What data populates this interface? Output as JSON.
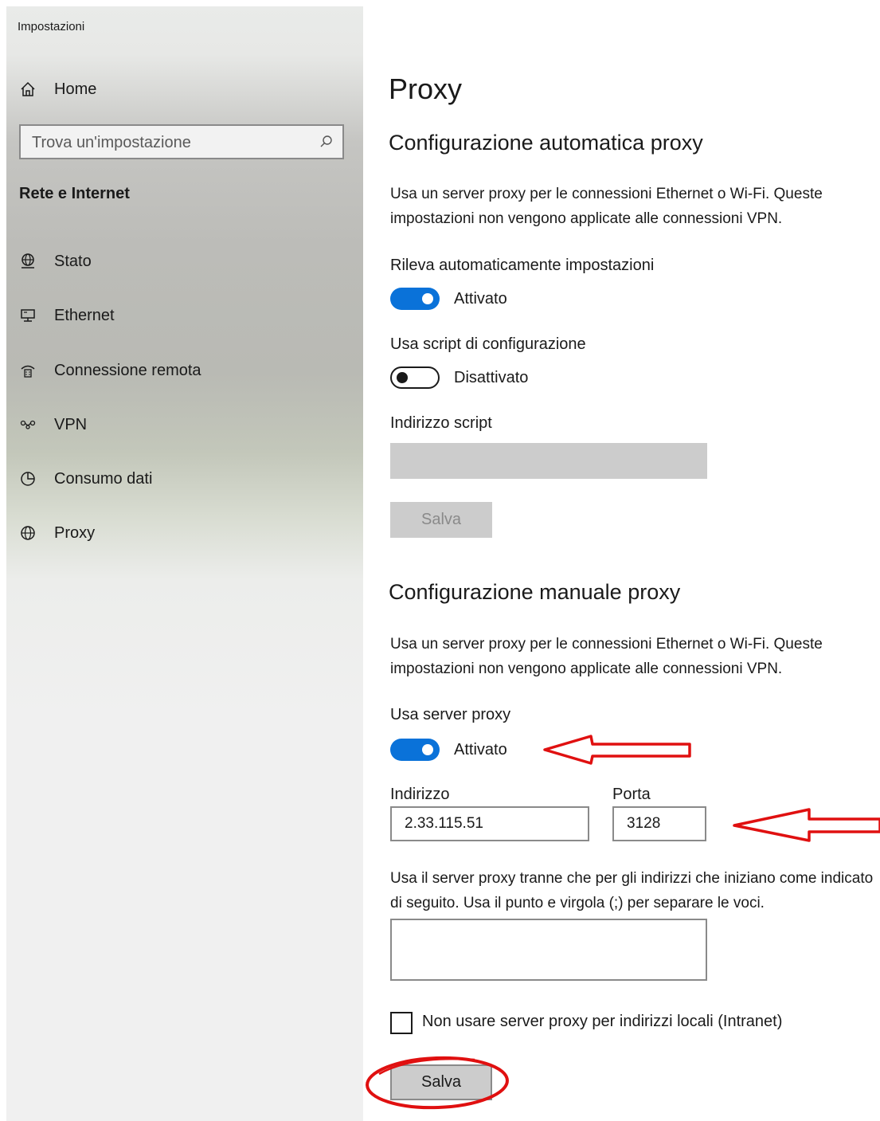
{
  "window": {
    "title": "Impostazioni"
  },
  "sidebar": {
    "home_label": "Home",
    "search_placeholder": "Trova un'impostazione",
    "section_title": "Rete e Internet",
    "items": [
      {
        "label": "Stato",
        "icon": "globe-status-icon"
      },
      {
        "label": "Ethernet",
        "icon": "ethernet-monitor-icon"
      },
      {
        "label": "Connessione remota",
        "icon": "dialup-icon"
      },
      {
        "label": "VPN",
        "icon": "vpn-icon"
      },
      {
        "label": "Consumo dati",
        "icon": "data-usage-icon"
      },
      {
        "label": "Proxy",
        "icon": "globe-icon"
      }
    ]
  },
  "main": {
    "title": "Proxy",
    "auto": {
      "heading": "Configurazione automatica proxy",
      "description": "Usa un server proxy per le connessioni Ethernet o Wi-Fi. Queste impostazioni non vengono applicate alle connessioni VPN.",
      "detect_label": "Rileva automaticamente impostazioni",
      "detect_state": "Attivato",
      "detect_on": true,
      "script_label": "Usa script di configurazione",
      "script_state": "Disattivato",
      "script_on": false,
      "script_address_label": "Indirizzo script",
      "script_address_value": "",
      "save_label": "Salva"
    },
    "manual": {
      "heading": "Configurazione manuale proxy",
      "description": "Usa un server proxy per le connessioni Ethernet o Wi-Fi. Queste impostazioni non vengono applicate alle connessioni VPN.",
      "use_proxy_label": "Usa server proxy",
      "use_proxy_state": "Attivato",
      "use_proxy_on": true,
      "address_label": "Indirizzo",
      "address_value": "2.33.115.51",
      "port_label": "Porta",
      "port_value": "3128",
      "exceptions_description": "Usa il server proxy tranne che per gli indirizzi che iniziano come indicato di seguito. Usa il punto e virgola (;) per separare le voci.",
      "exceptions_value": "",
      "local_bypass_label": "Non usare server proxy per indirizzi locali (Intranet)",
      "local_bypass_checked": false,
      "save_label": "Salva"
    }
  },
  "colors": {
    "accent": "#0a72d9",
    "annotation": "#e01010",
    "disabled": "#cccccc"
  }
}
